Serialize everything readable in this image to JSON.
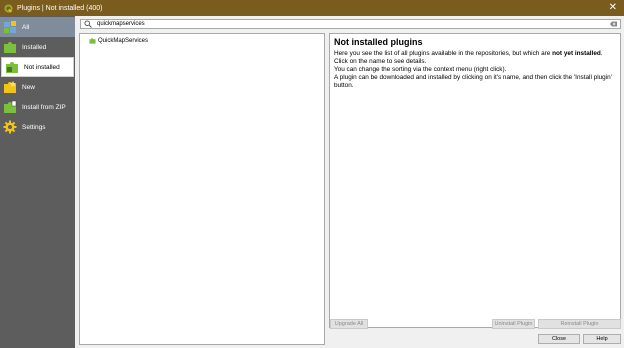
{
  "window": {
    "title": "Plugins | Not installed (400)",
    "close_glyph": "✕"
  },
  "sidebar": {
    "items": [
      {
        "label": "All",
        "icon": "puzzle-all-icon"
      },
      {
        "label": "Installed",
        "icon": "puzzle-installed-icon"
      },
      {
        "label": "Not installed",
        "icon": "puzzle-not-installed-icon"
      },
      {
        "label": "New",
        "icon": "puzzle-new-icon"
      },
      {
        "label": "Install from ZIP",
        "icon": "puzzle-zip-icon"
      },
      {
        "label": "Settings",
        "icon": "gear-icon"
      }
    ],
    "active_index": 2
  },
  "search": {
    "value": "quickmapservices"
  },
  "plugins": [
    {
      "name": "QuickMapServices"
    }
  ],
  "detail": {
    "title": "Not installed plugins",
    "line1_pre": "Here you see the list of all plugins available in the repositories, but which are ",
    "line1_bold": "not yet installed",
    "line1_post": ".",
    "line2": "Click on the name to see details.",
    "line3": "You can change the sorting via the context menu (right click).",
    "line4": "A plugin can be downloaded and installed by clicking on it's name, and then click the 'Install plugin' button."
  },
  "buttons": {
    "upgrade_all": "Upgrade All",
    "uninstall": "Uninstall Plugin",
    "reinstall": "Reinstall Plugin",
    "close": "Close",
    "help": "Help"
  },
  "colors": {
    "titlebar": "#7a5c1e",
    "sidebar": "#5d5d5d",
    "accent_green": "#7cbf3a",
    "gear_yellow": "#f0c419"
  }
}
